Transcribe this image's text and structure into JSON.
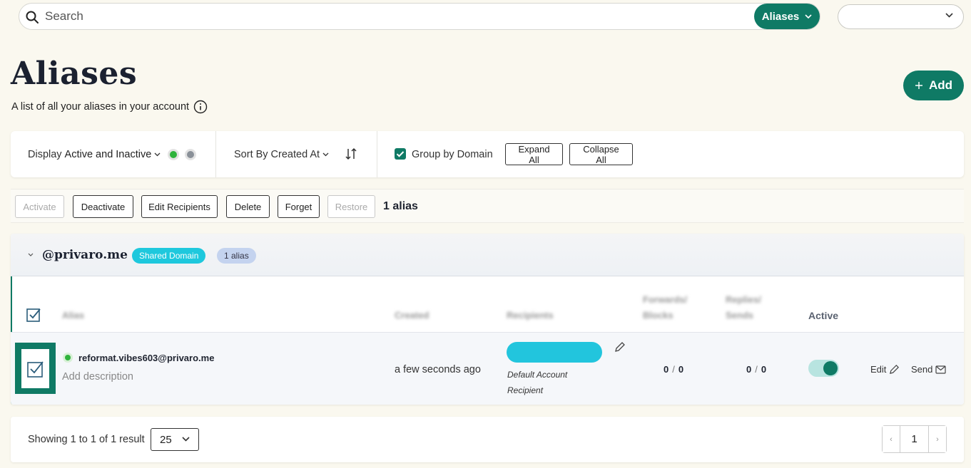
{
  "search": {
    "placeholder": "Search",
    "scope_label": "Aliases",
    "account_select_value": ""
  },
  "header": {
    "title": "Aliases",
    "subtitle": "A list of all your aliases in your account",
    "add_label": "Add"
  },
  "filters": {
    "display_prefix": "Display",
    "display_value": "Active and Inactive",
    "sort_prefix": "Sort By",
    "sort_value": "Created At",
    "group_by_domain_label": "Group by Domain",
    "group_by_domain_checked": true,
    "expand_all": "Expand All",
    "collapse_all": "Collapse All"
  },
  "bulk": {
    "activate": "Activate",
    "deactivate": "Deactivate",
    "edit_recipients": "Edit Recipients",
    "delete": "Delete",
    "forget": "Forget",
    "restore": "Restore",
    "count": "1 alias"
  },
  "domain_group": {
    "name": "@privaro.me",
    "type_badge": "Shared Domain",
    "count_badge": "1 alias",
    "columns": {
      "alias": "Alias",
      "created": "Created",
      "recipients": "Recipients",
      "forwards_1": "Forwards/",
      "forwards_2": "Blocks",
      "replies_1": "Replies/",
      "replies_2": "Sends",
      "active": "Active"
    },
    "rows": [
      {
        "email": "reformat.vibes603@privaro.me",
        "description_placeholder": "Add description",
        "created": "a few seconds ago",
        "recipient_note_1": "Default Account",
        "recipient_note_2": "Recipient",
        "forwards": "0",
        "blocks": "0",
        "replies": "0",
        "sends": "0",
        "stat_sep": "/",
        "active": true,
        "edit_label": "Edit",
        "send_label": "Send"
      }
    ]
  },
  "pagination": {
    "showing": "Showing 1 to 1 of 1 result",
    "per_page": "25",
    "prev": "‹",
    "current_page": "1",
    "next": "›"
  },
  "colors": {
    "brand": "#0f7a65",
    "shared_badge": "#1ec8dd",
    "count_badge": "#c4d3ef",
    "active_dot": "#2fb33c"
  }
}
